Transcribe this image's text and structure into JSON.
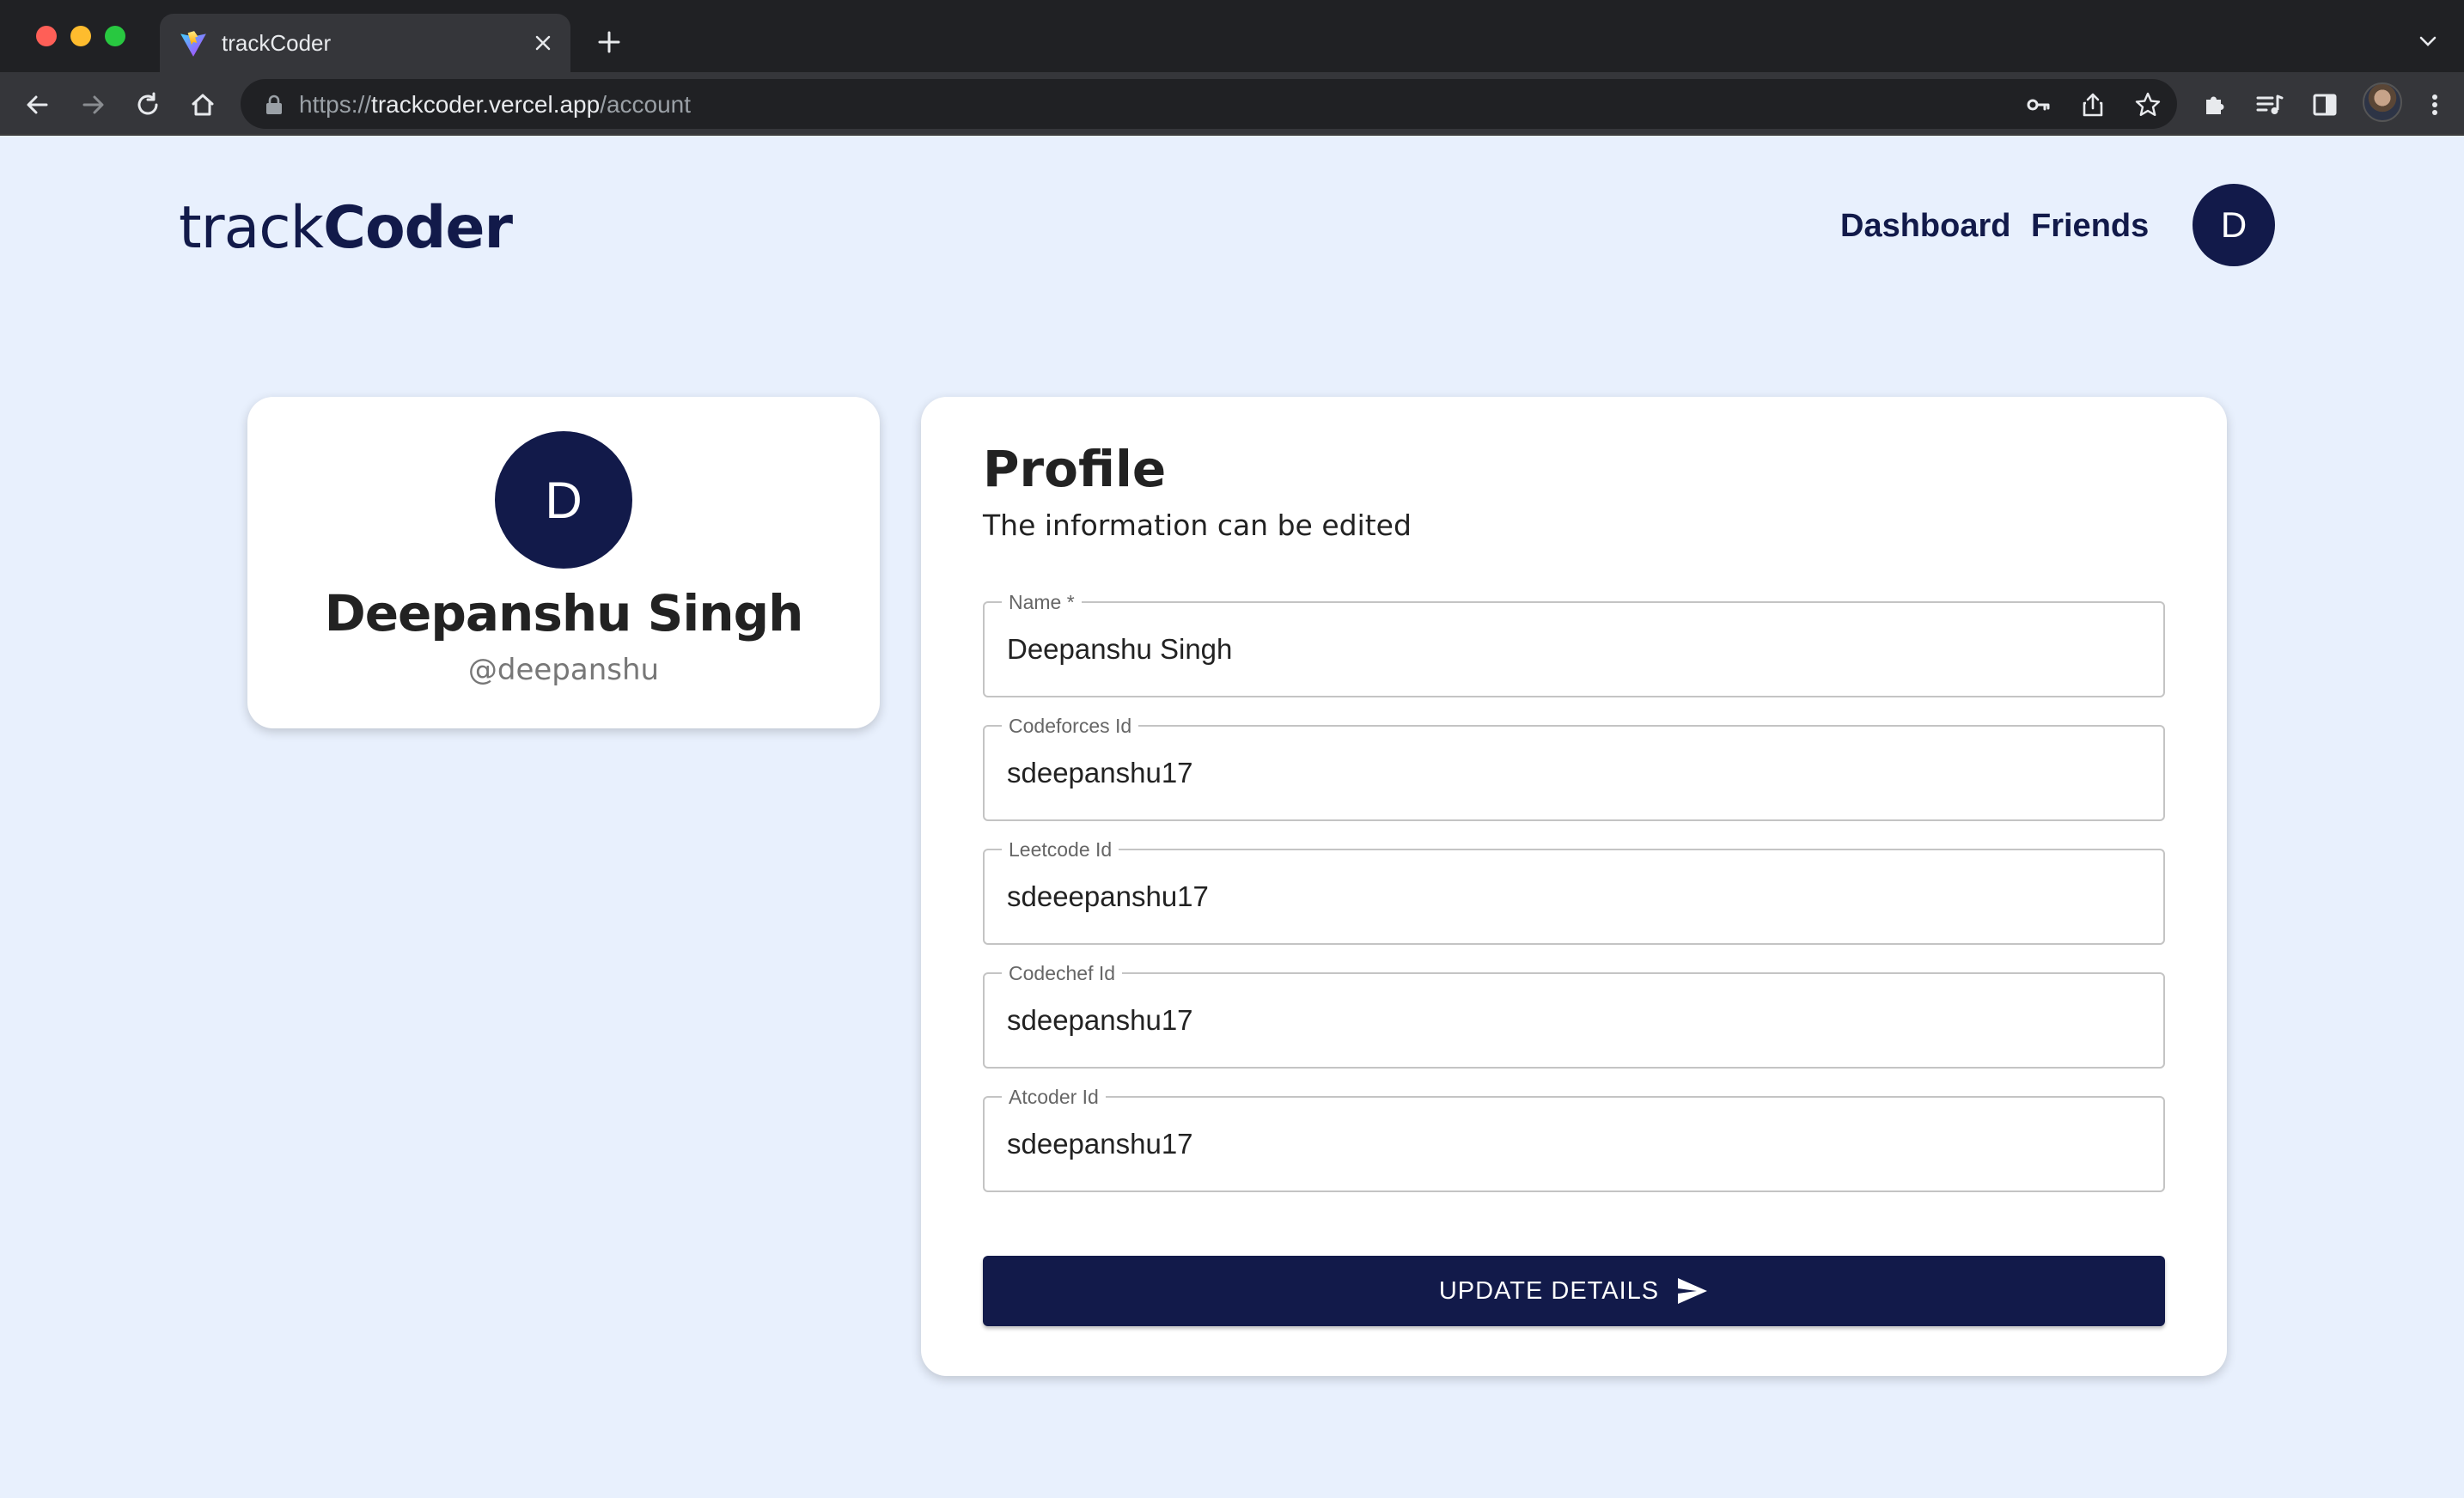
{
  "browser": {
    "tab_title": "trackCoder",
    "url_scheme": "https://",
    "url_host": "trackcoder.vercel.app",
    "url_path": "/account"
  },
  "header": {
    "logo_light": "track",
    "logo_bold": "Coder",
    "nav": {
      "dashboard": "Dashboard",
      "friends": "Friends"
    },
    "avatar_initial": "D"
  },
  "user_card": {
    "avatar_initial": "D",
    "name": "Deepanshu Singh",
    "handle": "@deepanshu"
  },
  "profile": {
    "title": "Profile",
    "subtitle": "The information can be edited",
    "fields": [
      {
        "label": "Name *",
        "value": "Deepanshu Singh"
      },
      {
        "label": "Codeforces Id",
        "value": "sdeepanshu17"
      },
      {
        "label": "Leetcode Id",
        "value": "sdeeepanshu17"
      },
      {
        "label": "Codechef Id",
        "value": "sdeepanshu17"
      },
      {
        "label": "Atcoder Id",
        "value": "sdeepanshu17"
      }
    ],
    "submit_label": "UPDATE DETAILS"
  },
  "colors": {
    "brand": "#121a4a",
    "page_bg": "#e8f0fd",
    "card_bg": "#ffffff"
  }
}
